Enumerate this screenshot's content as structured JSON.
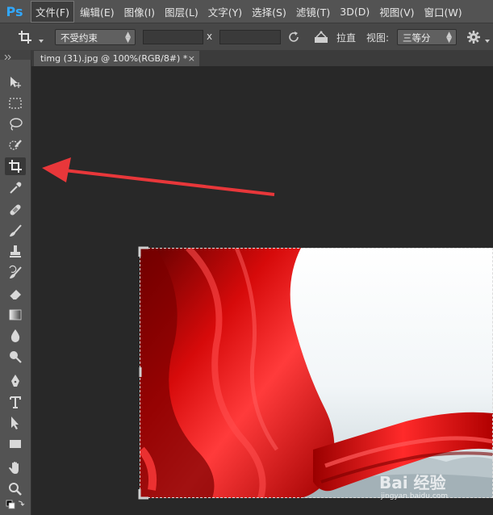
{
  "app": {
    "logo": "Ps"
  },
  "menu": {
    "items": [
      {
        "label": "文件(F)",
        "active": true
      },
      {
        "label": "编辑(E)"
      },
      {
        "label": "图像(I)"
      },
      {
        "label": "图层(L)"
      },
      {
        "label": "文字(Y)"
      },
      {
        "label": "选择(S)"
      },
      {
        "label": "滤镜(T)"
      },
      {
        "label": "3D(D)"
      },
      {
        "label": "视图(V)"
      },
      {
        "label": "窗口(W)"
      }
    ]
  },
  "options": {
    "ratio_value": "不受约束",
    "x_label": "x",
    "straighten_label": "拉直",
    "view_label": "视图:",
    "view_value": "三等分",
    "width_value": "",
    "height_value": ""
  },
  "document": {
    "tab_title": "timg (31).jpg @ 100%(RGB/8#) *",
    "close_glyph": "×"
  },
  "watermark": {
    "text": "Bai 经验",
    "sub": "jingyan.baidu.com"
  },
  "colors": {
    "accent": "#31a8ff",
    "arrow": "#e8373a",
    "silk": "#d60a0a"
  },
  "tools": [
    {
      "name": "move-tool-icon"
    },
    {
      "name": "marquee-tool-icon"
    },
    {
      "name": "lasso-tool-icon"
    },
    {
      "name": "quick-select-tool-icon"
    },
    {
      "name": "crop-tool-icon",
      "active": true
    },
    {
      "name": "eyedropper-tool-icon"
    },
    {
      "name": "healing-brush-tool-icon"
    },
    {
      "name": "brush-tool-icon"
    },
    {
      "name": "clone-stamp-tool-icon"
    },
    {
      "name": "history-brush-tool-icon"
    },
    {
      "name": "eraser-tool-icon"
    },
    {
      "name": "gradient-tool-icon"
    },
    {
      "name": "blur-tool-icon"
    },
    {
      "name": "dodge-tool-icon"
    },
    {
      "name": "pen-tool-icon"
    },
    {
      "name": "type-tool-icon"
    },
    {
      "name": "path-select-tool-icon"
    },
    {
      "name": "shape-tool-icon"
    },
    {
      "name": "hand-tool-icon"
    },
    {
      "name": "zoom-tool-icon"
    }
  ]
}
